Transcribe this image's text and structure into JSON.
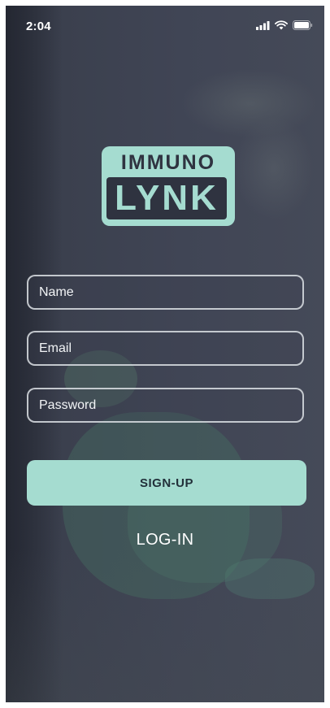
{
  "status_bar": {
    "time": "2:04",
    "icons": [
      "signal-bars-icon",
      "wifi-icon",
      "battery-icon"
    ]
  },
  "logo": {
    "top_text": "IMMUNO",
    "bottom_text": "LYNK"
  },
  "form": {
    "name_placeholder": "Name",
    "email_placeholder": "Email",
    "password_placeholder": "Password",
    "name_value": "",
    "email_value": "",
    "password_value": ""
  },
  "actions": {
    "signup_label": "SIGN-UP",
    "login_label": "LOG-IN"
  },
  "colors": {
    "accent": "#a5dcd0",
    "overlay": "#3c4150",
    "text": "#ffffff"
  }
}
